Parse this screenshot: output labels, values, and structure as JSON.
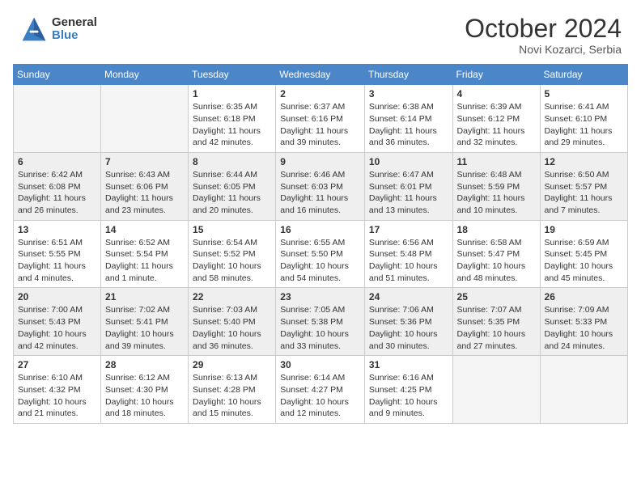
{
  "header": {
    "logo_general": "General",
    "logo_blue": "Blue",
    "month_year": "October 2024",
    "location": "Novi Kozarci, Serbia"
  },
  "weekdays": [
    "Sunday",
    "Monday",
    "Tuesday",
    "Wednesday",
    "Thursday",
    "Friday",
    "Saturday"
  ],
  "weeks": [
    [
      {
        "day": "",
        "sunrise": "",
        "sunset": "",
        "daylight": ""
      },
      {
        "day": "",
        "sunrise": "",
        "sunset": "",
        "daylight": ""
      },
      {
        "day": "1",
        "sunrise": "Sunrise: 6:35 AM",
        "sunset": "Sunset: 6:18 PM",
        "daylight": "Daylight: 11 hours and 42 minutes."
      },
      {
        "day": "2",
        "sunrise": "Sunrise: 6:37 AM",
        "sunset": "Sunset: 6:16 PM",
        "daylight": "Daylight: 11 hours and 39 minutes."
      },
      {
        "day": "3",
        "sunrise": "Sunrise: 6:38 AM",
        "sunset": "Sunset: 6:14 PM",
        "daylight": "Daylight: 11 hours and 36 minutes."
      },
      {
        "day": "4",
        "sunrise": "Sunrise: 6:39 AM",
        "sunset": "Sunset: 6:12 PM",
        "daylight": "Daylight: 11 hours and 32 minutes."
      },
      {
        "day": "5",
        "sunrise": "Sunrise: 6:41 AM",
        "sunset": "Sunset: 6:10 PM",
        "daylight": "Daylight: 11 hours and 29 minutes."
      }
    ],
    [
      {
        "day": "6",
        "sunrise": "Sunrise: 6:42 AM",
        "sunset": "Sunset: 6:08 PM",
        "daylight": "Daylight: 11 hours and 26 minutes."
      },
      {
        "day": "7",
        "sunrise": "Sunrise: 6:43 AM",
        "sunset": "Sunset: 6:06 PM",
        "daylight": "Daylight: 11 hours and 23 minutes."
      },
      {
        "day": "8",
        "sunrise": "Sunrise: 6:44 AM",
        "sunset": "Sunset: 6:05 PM",
        "daylight": "Daylight: 11 hours and 20 minutes."
      },
      {
        "day": "9",
        "sunrise": "Sunrise: 6:46 AM",
        "sunset": "Sunset: 6:03 PM",
        "daylight": "Daylight: 11 hours and 16 minutes."
      },
      {
        "day": "10",
        "sunrise": "Sunrise: 6:47 AM",
        "sunset": "Sunset: 6:01 PM",
        "daylight": "Daylight: 11 hours and 13 minutes."
      },
      {
        "day": "11",
        "sunrise": "Sunrise: 6:48 AM",
        "sunset": "Sunset: 5:59 PM",
        "daylight": "Daylight: 11 hours and 10 minutes."
      },
      {
        "day": "12",
        "sunrise": "Sunrise: 6:50 AM",
        "sunset": "Sunset: 5:57 PM",
        "daylight": "Daylight: 11 hours and 7 minutes."
      }
    ],
    [
      {
        "day": "13",
        "sunrise": "Sunrise: 6:51 AM",
        "sunset": "Sunset: 5:55 PM",
        "daylight": "Daylight: 11 hours and 4 minutes."
      },
      {
        "day": "14",
        "sunrise": "Sunrise: 6:52 AM",
        "sunset": "Sunset: 5:54 PM",
        "daylight": "Daylight: 11 hours and 1 minute."
      },
      {
        "day": "15",
        "sunrise": "Sunrise: 6:54 AM",
        "sunset": "Sunset: 5:52 PM",
        "daylight": "Daylight: 10 hours and 58 minutes."
      },
      {
        "day": "16",
        "sunrise": "Sunrise: 6:55 AM",
        "sunset": "Sunset: 5:50 PM",
        "daylight": "Daylight: 10 hours and 54 minutes."
      },
      {
        "day": "17",
        "sunrise": "Sunrise: 6:56 AM",
        "sunset": "Sunset: 5:48 PM",
        "daylight": "Daylight: 10 hours and 51 minutes."
      },
      {
        "day": "18",
        "sunrise": "Sunrise: 6:58 AM",
        "sunset": "Sunset: 5:47 PM",
        "daylight": "Daylight: 10 hours and 48 minutes."
      },
      {
        "day": "19",
        "sunrise": "Sunrise: 6:59 AM",
        "sunset": "Sunset: 5:45 PM",
        "daylight": "Daylight: 10 hours and 45 minutes."
      }
    ],
    [
      {
        "day": "20",
        "sunrise": "Sunrise: 7:00 AM",
        "sunset": "Sunset: 5:43 PM",
        "daylight": "Daylight: 10 hours and 42 minutes."
      },
      {
        "day": "21",
        "sunrise": "Sunrise: 7:02 AM",
        "sunset": "Sunset: 5:41 PM",
        "daylight": "Daylight: 10 hours and 39 minutes."
      },
      {
        "day": "22",
        "sunrise": "Sunrise: 7:03 AM",
        "sunset": "Sunset: 5:40 PM",
        "daylight": "Daylight: 10 hours and 36 minutes."
      },
      {
        "day": "23",
        "sunrise": "Sunrise: 7:05 AM",
        "sunset": "Sunset: 5:38 PM",
        "daylight": "Daylight: 10 hours and 33 minutes."
      },
      {
        "day": "24",
        "sunrise": "Sunrise: 7:06 AM",
        "sunset": "Sunset: 5:36 PM",
        "daylight": "Daylight: 10 hours and 30 minutes."
      },
      {
        "day": "25",
        "sunrise": "Sunrise: 7:07 AM",
        "sunset": "Sunset: 5:35 PM",
        "daylight": "Daylight: 10 hours and 27 minutes."
      },
      {
        "day": "26",
        "sunrise": "Sunrise: 7:09 AM",
        "sunset": "Sunset: 5:33 PM",
        "daylight": "Daylight: 10 hours and 24 minutes."
      }
    ],
    [
      {
        "day": "27",
        "sunrise": "Sunrise: 6:10 AM",
        "sunset": "Sunset: 4:32 PM",
        "daylight": "Daylight: 10 hours and 21 minutes."
      },
      {
        "day": "28",
        "sunrise": "Sunrise: 6:12 AM",
        "sunset": "Sunset: 4:30 PM",
        "daylight": "Daylight: 10 hours and 18 minutes."
      },
      {
        "day": "29",
        "sunrise": "Sunrise: 6:13 AM",
        "sunset": "Sunset: 4:28 PM",
        "daylight": "Daylight: 10 hours and 15 minutes."
      },
      {
        "day": "30",
        "sunrise": "Sunrise: 6:14 AM",
        "sunset": "Sunset: 4:27 PM",
        "daylight": "Daylight: 10 hours and 12 minutes."
      },
      {
        "day": "31",
        "sunrise": "Sunrise: 6:16 AM",
        "sunset": "Sunset: 4:25 PM",
        "daylight": "Daylight: 10 hours and 9 minutes."
      },
      {
        "day": "",
        "sunrise": "",
        "sunset": "",
        "daylight": ""
      },
      {
        "day": "",
        "sunrise": "",
        "sunset": "",
        "daylight": ""
      }
    ]
  ]
}
